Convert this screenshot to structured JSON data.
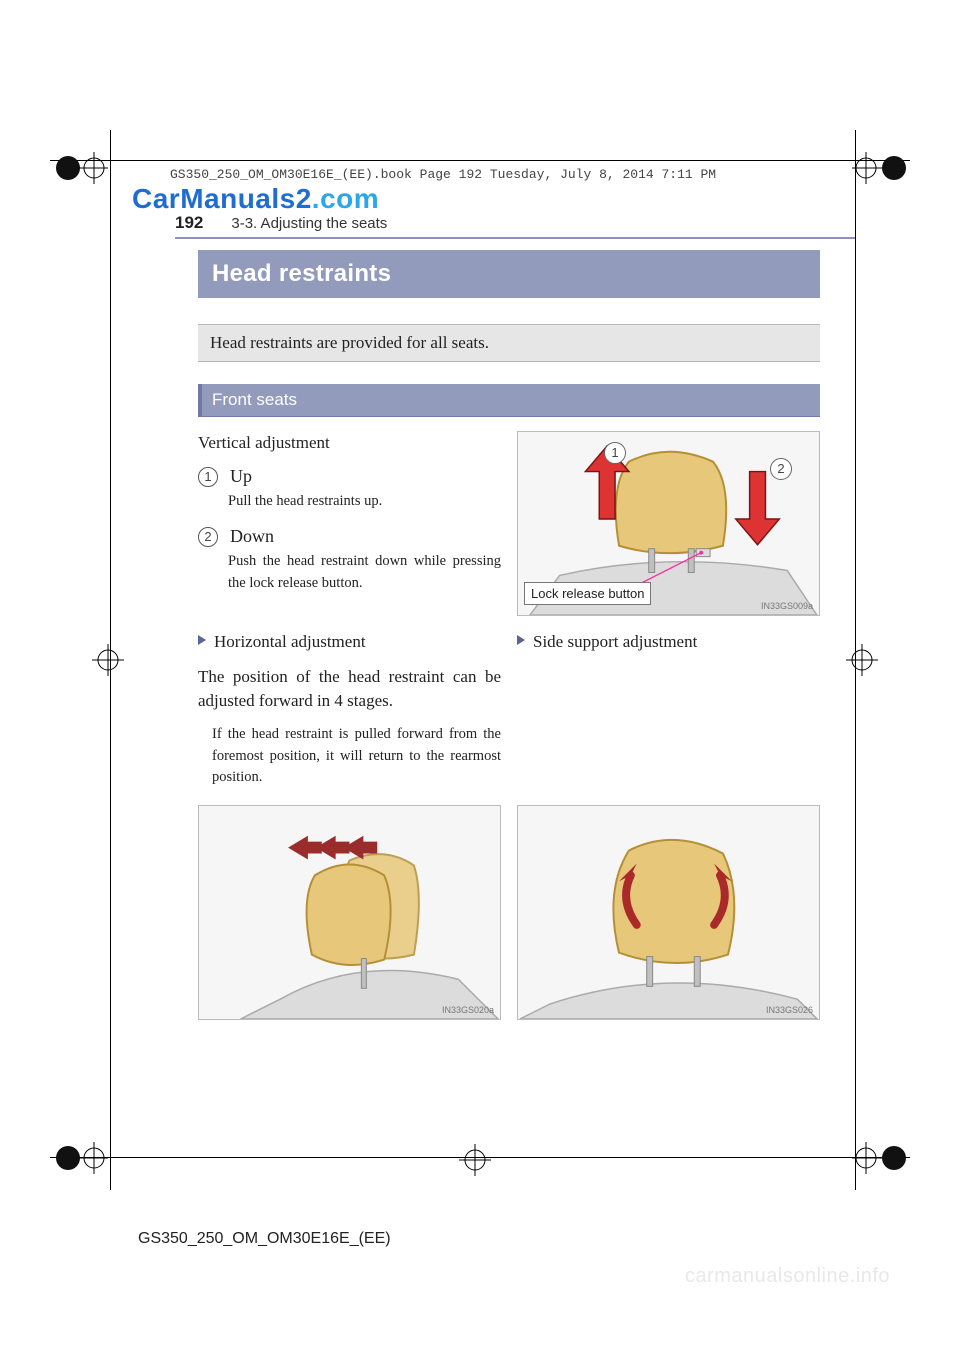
{
  "meta": {
    "book_line": "GS350_250_OM_OM30E16E_(EE).book  Page 192  Tuesday, July 8, 2014  7:11 PM",
    "watermark_top_a": "CarManuals2",
    "watermark_top_b": ".com",
    "watermark_bottom": "carmanualsonline.info",
    "footer_code": "GS350_250_OM_OM30E16E_(EE)"
  },
  "header": {
    "page_number": "192",
    "section": "3-3. Adjusting the seats"
  },
  "title": "Head restraints",
  "intro": "Head restraints are provided for all seats.",
  "front_seats_label": "Front seats",
  "vertical": {
    "heading": "Vertical adjustment",
    "steps": [
      {
        "num": "1",
        "label": "Up",
        "note": "Pull the head restraints up."
      },
      {
        "num": "2",
        "label": "Down",
        "note": "Push the head restraint down while pressing the lock release button."
      }
    ]
  },
  "figureA": {
    "callout": "Lock release button",
    "badge1": "1",
    "badge2": "2",
    "code": "IN33GS009a"
  },
  "horizontal": {
    "heading": "Horizontal adjustment",
    "body": "The position of the head restraint can be adjusted forward in 4 stages.",
    "note": "If the head restraint is pulled forward from the foremost position, it will return to the rearmost position."
  },
  "side": {
    "heading": "Side support adjustment"
  },
  "figureB": {
    "code": "IN33GS020a"
  },
  "figureC": {
    "code": "IN33GS026"
  }
}
